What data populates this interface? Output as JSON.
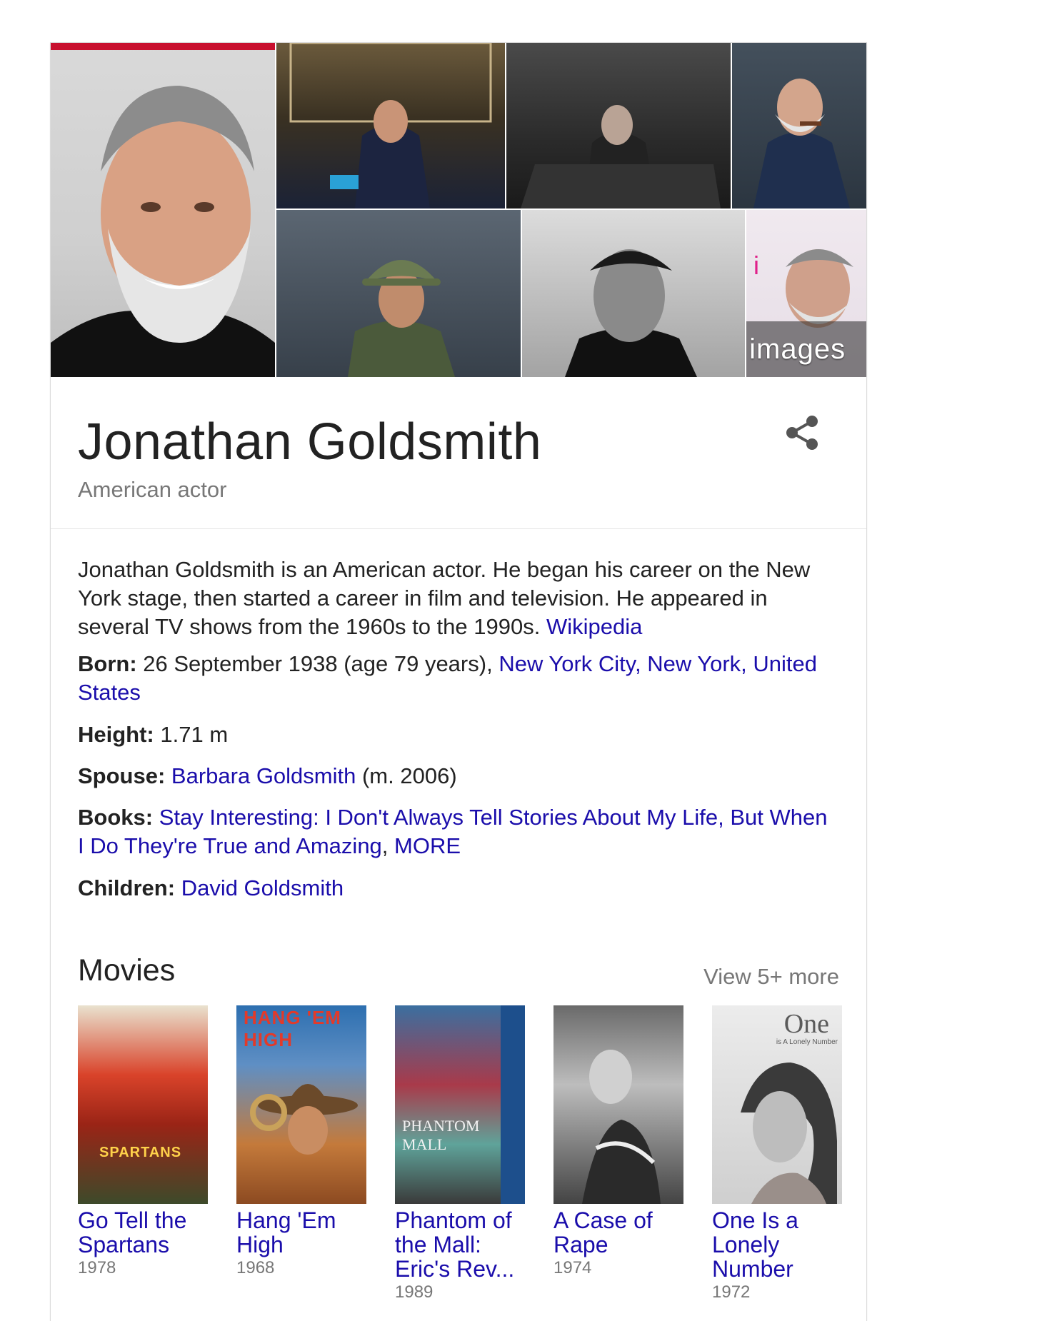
{
  "gallery": {
    "more_images_label": "More images",
    "images": [
      "portrait-smiling",
      "seated-pouring-drink",
      "seated-dark-room",
      "lighting-cigar",
      "soldier-bucket-hat",
      "vintage-black-white-portrait",
      "red-carpet-portrait"
    ]
  },
  "entity": {
    "name": "Jonathan Goldsmith",
    "subtitle": "American actor"
  },
  "description": {
    "text": "Jonathan Goldsmith is an American actor. He began his career on the New York stage, then started a career in film and television. He appeared in several TV shows from the 1960s to the 1990s. ",
    "source_link": "Wikipedia"
  },
  "facts": {
    "born": {
      "label": "Born:",
      "text": " 26 September 1938 (age 79 years), ",
      "link": "New York City, New York, United States"
    },
    "height": {
      "label": "Height:",
      "text": " 1.71 m"
    },
    "spouse": {
      "label": "Spouse:",
      "link": "Barbara Goldsmith",
      "text": " (m. 2006)"
    },
    "books": {
      "label": "Books:",
      "link": "Stay Interesting: I Don't Always Tell Stories About My Life, But When I Do They're True and Amazing",
      "sep": ", ",
      "more": "MORE"
    },
    "children": {
      "label": "Children:",
      "link": "David Goldsmith"
    }
  },
  "movies": {
    "heading": "Movies",
    "view_more": "View 5+ more",
    "items": [
      {
        "title": "Go Tell the Spartans",
        "year": "1978",
        "poster_text": "SPARTANS"
      },
      {
        "title": "Hang 'Em High",
        "year": "1968",
        "poster_text": "HANG 'EM HIGH"
      },
      {
        "title": "Phantom of the Mall: Eric's Rev...",
        "year": "1989",
        "poster_text": "PHANTOM MALL"
      },
      {
        "title": "A Case of Rape",
        "year": "1974",
        "poster_text": ""
      },
      {
        "title": "One Is a Lonely Number",
        "year": "1972",
        "poster_text": "One",
        "poster_subtext": "is A Lonely Number"
      }
    ]
  },
  "colors": {
    "link": "#1a0dab",
    "muted": "#777777",
    "text": "#222222"
  }
}
